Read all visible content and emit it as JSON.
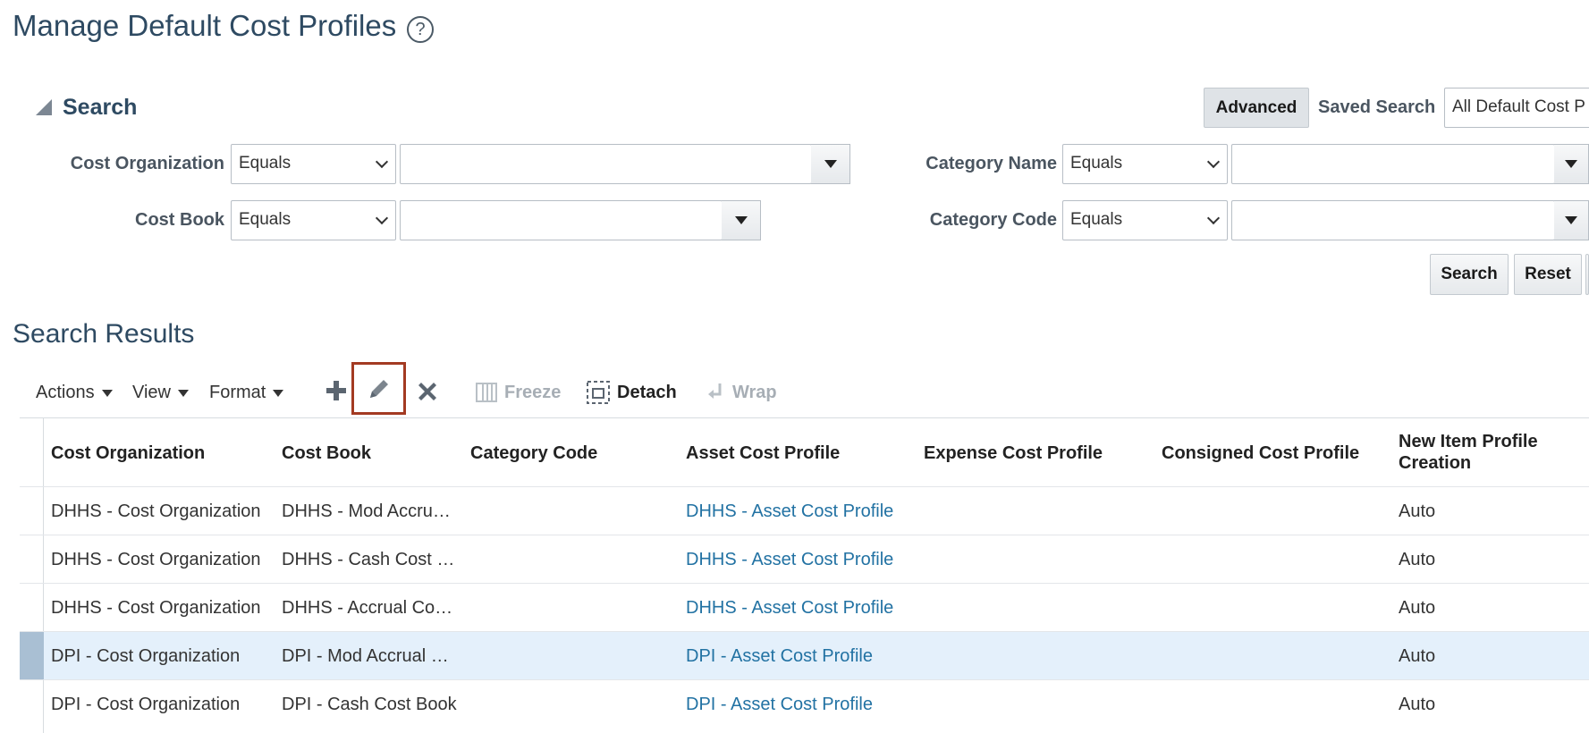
{
  "header": {
    "title": "Manage Default Cost Profiles",
    "help_glyph": "?"
  },
  "search": {
    "heading": "Search",
    "advanced_label": "Advanced",
    "saved_search_label": "Saved Search",
    "saved_search_value": "All Default Cost P",
    "fields": {
      "cost_org_label": "Cost Organization",
      "cost_org_operator": "Equals",
      "cost_book_label": "Cost Book",
      "cost_book_operator": "Equals",
      "category_name_label": "Category Name",
      "category_name_operator": "Equals",
      "category_code_label": "Category Code",
      "category_code_operator": "Equals"
    },
    "search_button": "Search",
    "reset_button": "Reset"
  },
  "results": {
    "title": "Search Results",
    "toolbar": {
      "actions": "Actions",
      "view": "View",
      "format": "Format",
      "freeze": "Freeze",
      "detach": "Detach",
      "wrap": "Wrap"
    },
    "columns": {
      "cost_org": "Cost Organization",
      "cost_book": "Cost Book",
      "category_code": "Category Code",
      "asset_profile": "Asset Cost Profile",
      "expense_profile": "Expense Cost Profile",
      "consigned_profile": "Consigned Cost Profile",
      "new_item_line1": "New Item Profile",
      "new_item_line2": "Creation"
    },
    "rows": [
      {
        "cost_org": "DHHS - Cost Organization",
        "cost_book": "DHHS - Mod Accru…",
        "category_code": "",
        "asset_profile": "DHHS - Asset Cost Profile",
        "expense_profile": "",
        "consigned_profile": "",
        "new_item": "Auto"
      },
      {
        "cost_org": "DHHS - Cost Organization",
        "cost_book": "DHHS - Cash Cost …",
        "category_code": "",
        "asset_profile": "DHHS - Asset Cost Profile",
        "expense_profile": "",
        "consigned_profile": "",
        "new_item": "Auto"
      },
      {
        "cost_org": "DHHS - Cost Organization",
        "cost_book": "DHHS - Accrual Co…",
        "category_code": "",
        "asset_profile": "DHHS - Asset Cost Profile",
        "expense_profile": "",
        "consigned_profile": "",
        "new_item": "Auto"
      },
      {
        "cost_org": "DPI - Cost Organization",
        "cost_book": "DPI - Mod Accrual …",
        "category_code": "",
        "asset_profile": "DPI - Asset Cost Profile",
        "expense_profile": "",
        "consigned_profile": "",
        "new_item": "Auto",
        "selected": true
      },
      {
        "cost_org": "DPI - Cost Organization",
        "cost_book": "DPI - Cash Cost Book",
        "category_code": "",
        "asset_profile": "DPI - Asset Cost Profile",
        "expense_profile": "",
        "consigned_profile": "",
        "new_item": "Auto"
      }
    ]
  },
  "colors": {
    "title": "#2e4a62",
    "link": "#2272a3",
    "selected_row": "#e4f0fb",
    "edit_highlight": "#a33a22"
  }
}
